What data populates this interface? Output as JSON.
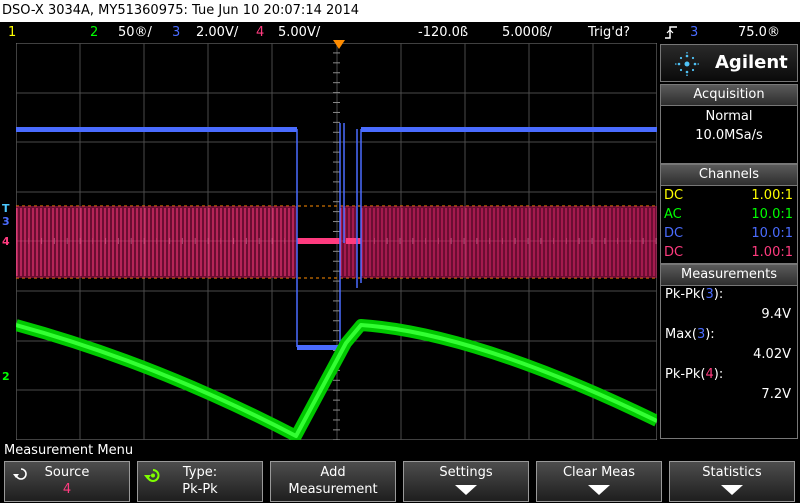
{
  "title": "DSO-X 3034A, MY51360975: Tue Jun 10 20:07:14 2014",
  "status_bar": {
    "ch1": "1",
    "ch2": "2",
    "ch2_scale": "50®/",
    "ch3": "3",
    "ch3_scale": "2.00V/",
    "ch4": "4",
    "ch4_scale": "5.00V/",
    "delay": "-120.0ß",
    "timebase": "5.000ß/",
    "trigger_status": "Trig'd?",
    "trigger_source": "3",
    "trigger_level": "75.0®",
    "trigger_icon": "trigger-edge-rising-icon"
  },
  "colors": {
    "ch1": "#ffff00",
    "ch2": "#00ff00",
    "ch3": "#4a6cff",
    "ch4": "#ff3b7f",
    "ground_marker": "#4cc8ff",
    "trigger_marker": "#ff8c00"
  },
  "brand": {
    "name": "Agilent"
  },
  "acquisition": {
    "header": "Acquisition",
    "mode": "Normal",
    "rate": "10.0MSa/s"
  },
  "channels": {
    "header": "Channels",
    "rows": [
      {
        "coupling": "DC",
        "probe": "1.00:1",
        "color": "#ffff00"
      },
      {
        "coupling": "AC",
        "probe": "10.0:1",
        "color": "#00ff00"
      },
      {
        "coupling": "DC",
        "probe": "10.0:1",
        "color": "#4a6cff"
      },
      {
        "coupling": "DC",
        "probe": "1.00:1",
        "color": "#ff3b7f"
      }
    ]
  },
  "measurements": {
    "header": "Measurements",
    "items": [
      {
        "name": "Pk-Pk(",
        "ch": "3",
        "close": "):",
        "value": "9.4V",
        "color": "#4a6cff"
      },
      {
        "name": "Max(",
        "ch": "3",
        "close": "):",
        "value": "4.02V",
        "color": "#4a6cff"
      },
      {
        "name": "Pk-Pk(",
        "ch": "4",
        "close": "):",
        "value": "7.2V",
        "color": "#ff3b7f"
      }
    ]
  },
  "graticule_markers": {
    "ch3": "3",
    "ch4": "4",
    "ch2": "2",
    "trigger": "T"
  },
  "menu": {
    "title": "Measurement Menu",
    "softkeys": [
      {
        "label": "Source",
        "value": "4"
      },
      {
        "label": "Type:",
        "value": "Pk-Pk",
        "icon": "rotate-knob-icon"
      },
      {
        "label": "Add",
        "value": "Measurement"
      },
      {
        "label": "Settings",
        "value": ""
      },
      {
        "label": "Clear Meas",
        "value": ""
      },
      {
        "label": "Statistics",
        "value": ""
      }
    ]
  }
}
